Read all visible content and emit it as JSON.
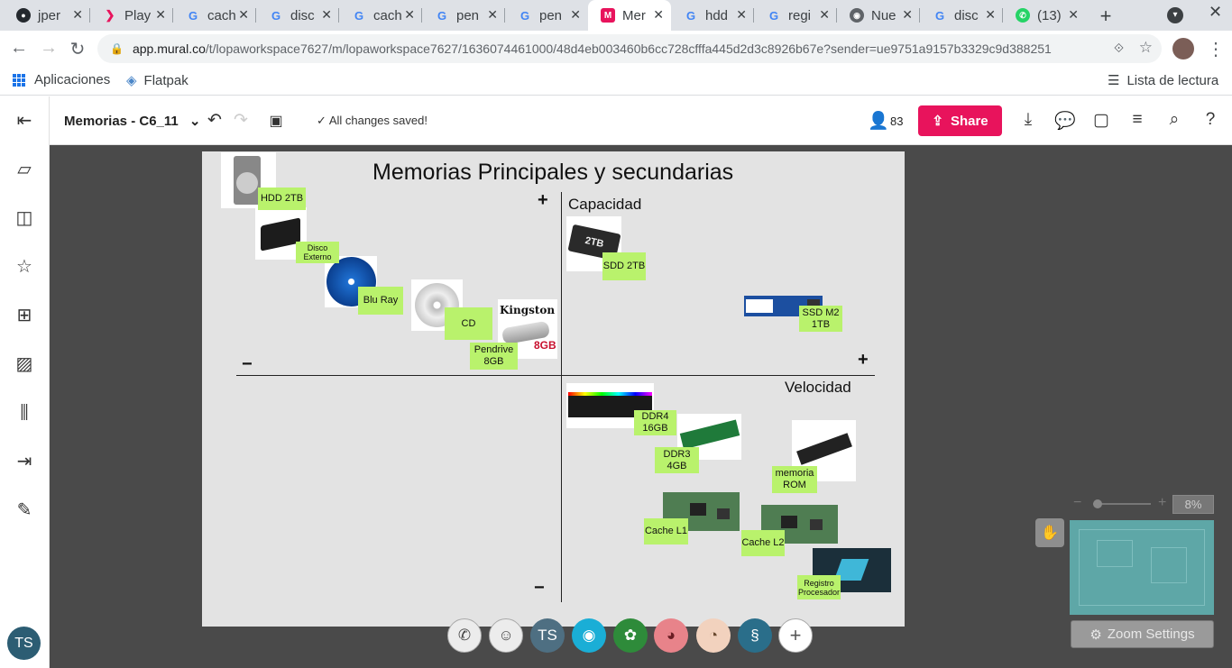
{
  "browser": {
    "tabs": [
      {
        "label": "jper",
        "icon": "github-icon"
      },
      {
        "label": "Play",
        "icon": "play-icon"
      },
      {
        "label": "cach",
        "icon": "google-icon"
      },
      {
        "label": "disc",
        "icon": "google-icon"
      },
      {
        "label": "cach",
        "icon": "google-icon"
      },
      {
        "label": "pen",
        "icon": "google-icon"
      },
      {
        "label": "pen",
        "icon": "google-icon"
      },
      {
        "label": "Mer",
        "icon": "mural-icon"
      },
      {
        "label": "hdd",
        "icon": "google-icon"
      },
      {
        "label": "regi",
        "icon": "google-icon"
      },
      {
        "label": "Nue",
        "icon": "chrome-icon"
      },
      {
        "label": "disc",
        "icon": "google-icon"
      },
      {
        "label": "(13)",
        "icon": "whatsapp-icon"
      }
    ],
    "url_host": "app.mural.co",
    "url_path": "/t/lopaworkspace7627/m/lopaworkspace7627/1636074461000/48d4eb003460b6cc728cfffa445d2d3c8926b67e?sender=ue9751a9157b3329c9d388251",
    "bookmarks": {
      "apps": "Aplicaciones",
      "flatpak": "Flatpak",
      "reading_list": "Lista de lectura"
    }
  },
  "app": {
    "title": "Memorias - C6_11",
    "saved_status": "All changes saved!",
    "members_count": "83",
    "share_label": "Share",
    "user_initials": "TS"
  },
  "board": {
    "title": "Memorias Principales y secundarias",
    "axis_y_label": "Capacidad",
    "axis_x_label": "Velocidad",
    "plus": "+",
    "minus": "−",
    "stickies": {
      "hdd": "HDD 2TB",
      "disco": "Disco Externo",
      "bluray": "Blu Ray",
      "cd": "CD",
      "pendrive": "Pendrive 8GB",
      "ssd2": "SDD 2TB",
      "ssdm2": "SSD M2 1TB",
      "ddr4": "DDR4 16GB",
      "ddr3": "DDR3 4GB",
      "rom": "memoria ROM",
      "l1": "Cache L1",
      "l2": "Cache L2",
      "reg": "Registro Procesador"
    },
    "image_text": {
      "ssd": "2TB",
      "kingston": "Kingston",
      "pendrive_size": "8GB"
    }
  },
  "zoom": {
    "level": "8%",
    "settings_label": "Zoom Settings"
  },
  "collaborators": {
    "ts": "TS"
  }
}
